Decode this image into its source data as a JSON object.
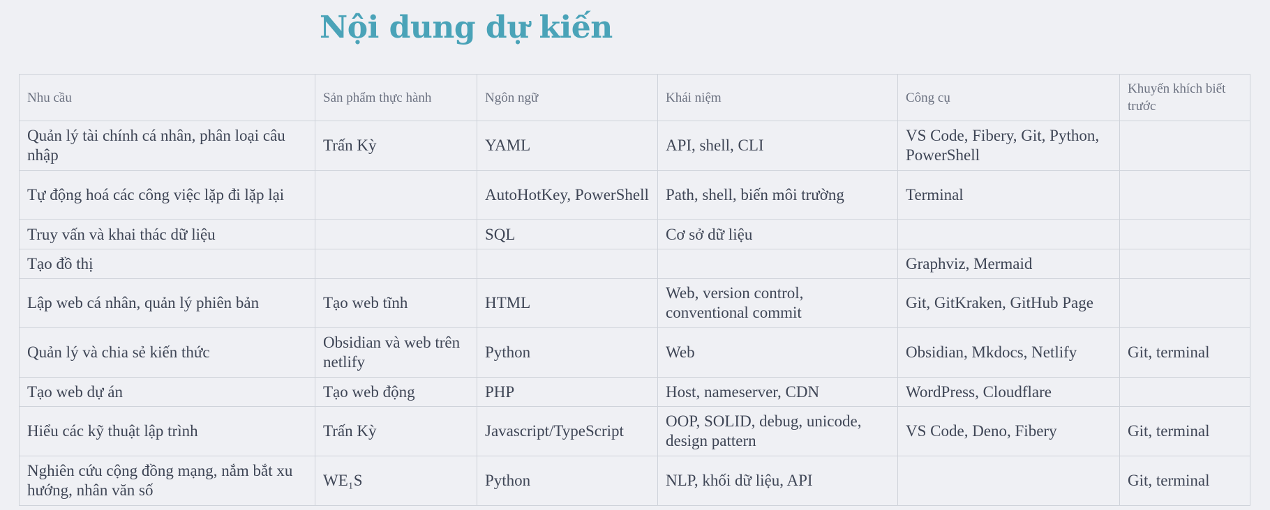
{
  "page_title": "Nội dung dự kiến",
  "table": {
    "headers": [
      "Nhu cầu",
      "Sản phẩm thực hành",
      "Ngôn ngữ",
      "Khái niệm",
      "Công cụ",
      "Khuyến khích biết trước"
    ],
    "rows": [
      [
        "Quản lý tài chính cá nhân, phân loại câu nhập",
        "Trấn Kỳ",
        "YAML",
        "API, shell, CLI",
        "VS Code, Fibery, Git, Python, PowerShell",
        ""
      ],
      [
        "Tự động hoá các công việc lặp đi lặp lại",
        "",
        "AutoHotKey, PowerShell",
        "Path, shell, biến môi trường",
        "Terminal",
        ""
      ],
      [
        "Truy vấn và khai thác dữ liệu",
        "",
        "SQL",
        "Cơ sở dữ liệu",
        "",
        ""
      ],
      [
        "Tạo đồ thị",
        "",
        "",
        "",
        "Graphviz, Mermaid",
        ""
      ],
      [
        "Lập web cá nhân, quản lý phiên bản",
        "Tạo web tĩnh",
        "HTML",
        "Web, version control, conventional commit",
        "Git, GitKraken, GitHub Page",
        ""
      ],
      [
        "Quản lý và chia sẻ kiến thức",
        "Obsidian và web trên netlify",
        "Python",
        "Web",
        "Obsidian, Mkdocs, Netlify",
        "Git, terminal"
      ],
      [
        "Tạo web dự án",
        "Tạo web động",
        "PHP",
        "Host, nameserver, CDN",
        "WordPress, Cloudflare",
        ""
      ],
      [
        "Hiểu các kỹ thuật lập trình",
        "Trấn Kỳ",
        "Javascript/TypeScript",
        "OOP, SOLID, debug, unicode, design pattern",
        "VS Code, Deno, Fibery",
        "Git, terminal"
      ],
      [
        "Nghiên cứu cộng đồng mạng, nắm bắt xu hướng, nhân văn số",
        "WE₁S",
        "Python",
        "NLP, khối dữ liệu, API",
        "",
        "Git, terminal"
      ]
    ]
  }
}
